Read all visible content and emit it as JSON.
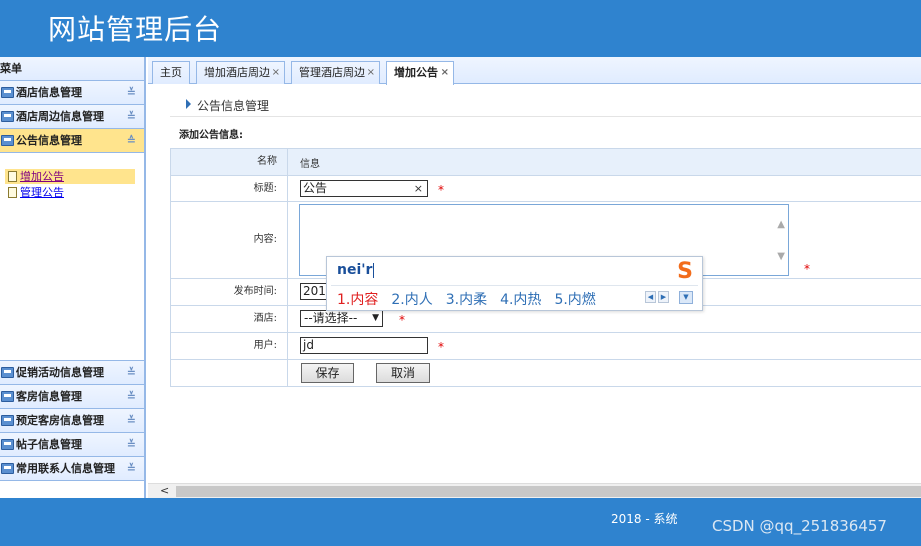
{
  "header": {
    "title": "网站管理后台"
  },
  "sidebar": {
    "menu_title": "菜单",
    "panels_top": [
      {
        "label": "酒店信息管理",
        "icon": "printer-icon"
      },
      {
        "label": "酒店周边信息管理",
        "icon": "printer-icon"
      },
      {
        "label": "公告信息管理",
        "icon": "printer-icon",
        "active": true
      }
    ],
    "active_items": [
      {
        "label": "增加公告",
        "selected": true
      },
      {
        "label": "管理公告"
      }
    ],
    "panels_bottom": [
      {
        "label": "促销活动信息管理"
      },
      {
        "label": "客房信息管理"
      },
      {
        "label": "预定客房信息管理"
      },
      {
        "label": "帖子信息管理"
      },
      {
        "label": "常用联系人信息管理"
      }
    ],
    "chevron_down": "≚",
    "chevron_up": "≙"
  },
  "tabs": [
    {
      "label": "主页"
    },
    {
      "label": "增加酒店周边",
      "closable": true
    },
    {
      "label": "管理酒店周边",
      "closable": true
    },
    {
      "label": "增加公告",
      "closable": true,
      "active": true
    }
  ],
  "close_glyph": "×",
  "content": {
    "breadcrumb": "公告信息管理",
    "subtitle": "添加公告信息:",
    "form": {
      "head_name": "名称",
      "head_info": "信息",
      "title_label": "标题:",
      "title_value": "公告",
      "content_label": "内容:",
      "publish_label": "发布时间:",
      "publish_value": "2018",
      "hotel_label": "酒店:",
      "hotel_select": "--请选择--",
      "user_label": "用户:",
      "user_value": "jd",
      "required_mark": "*",
      "save_button": "保存",
      "cancel_button": "取消"
    }
  },
  "ime": {
    "pinyin": "nei'r",
    "candidates": [
      "1.内容",
      "2.内人",
      "3.内柔",
      "4.内热",
      "5.内燃"
    ],
    "logo_glyph": "S"
  },
  "footer": {
    "copyright": "2018 - 系统",
    "watermark": "CSDN @qq_251836457"
  }
}
